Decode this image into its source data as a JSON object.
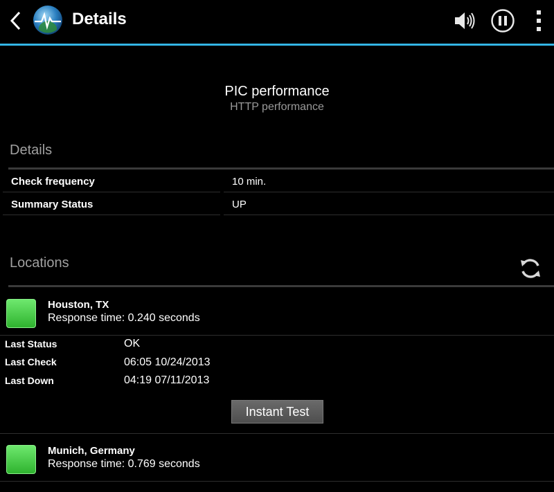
{
  "actionbar": {
    "title": "Details",
    "icons": [
      "back-chevron-icon",
      "app-heartbeat-icon",
      "speaker-icon",
      "pause-icon",
      "overflow-menu-icon"
    ]
  },
  "header": {
    "title": "PIC performance",
    "subtitle": "HTTP performance"
  },
  "details": {
    "section_label": "Details",
    "rows": [
      {
        "key": "Check frequency",
        "value": "10 min."
      },
      {
        "key": "Summary Status",
        "value": "UP"
      }
    ]
  },
  "locations": {
    "section_label": "Locations",
    "items": [
      {
        "name": "Houston, TX",
        "response": "Response time: 0.240 seconds",
        "status_color": "#3cc83c",
        "details": [
          {
            "key": "Last Status",
            "value": "OK"
          },
          {
            "key": "Last Check",
            "value": "06:05 10/24/2013"
          },
          {
            "key": "Last Down",
            "value": "04:19 07/11/2013"
          }
        ],
        "button_label": "Instant Test"
      },
      {
        "name": "Munich, Germany",
        "response": "Response time: 0.769 seconds",
        "status_color": "#3cc83c"
      }
    ]
  },
  "colors": {
    "accent": "#33b5e5",
    "background": "#000000",
    "secondary_text": "#9a9a9a"
  }
}
